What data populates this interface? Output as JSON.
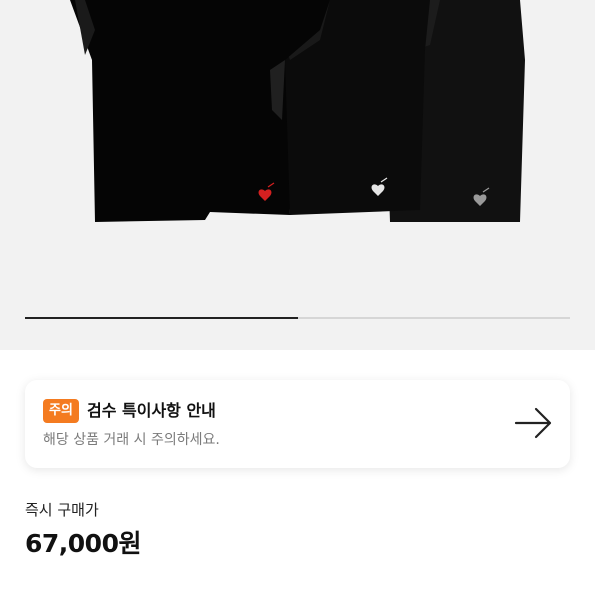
{
  "gallery": {
    "image_description_icon": "black-tshirts-image",
    "progress": 0.5
  },
  "notice": {
    "badge": "주의",
    "badge_color": "#f47b20",
    "title": "검수 특이사항 안내",
    "subtitle": "해당 상품 거래 시 주의하세요.",
    "arrow_icon": "arrow-right-icon"
  },
  "price": {
    "label": "즉시 구매가",
    "value": "67,000원"
  }
}
